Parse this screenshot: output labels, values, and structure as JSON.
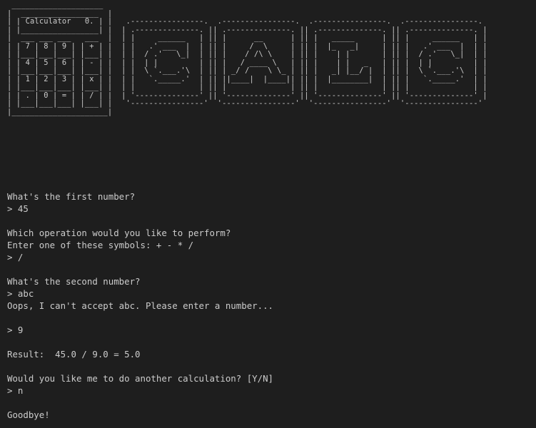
{
  "banner": {
    "art": [
      " ____________________",
      "|  _________________  |",
      "| | Calculator   0. | |   .----------------.  .----------------.  .----------------.  .----------------.",
      "| |_________________| |  | .--------------. || .--------------. || .--------------. || .--------------. |",
      "|  ___ ___ ___   ___  |  | |     ______   | || |      __      | || |   _____      | || |     ______   | |",
      "| | 7 | 8 | 9 | | + | |  | |   .' ___  |  | || |     /  \\     | || |  |_   _|     | || |   .' ___  |  | |",
      "| |___|___|___| |___| |  | |  / .'   \\_|  | || |    / /\\ \\    | || |    | |       | || |  / .'   \\_|  | |",
      "| | 4 | 5 | 6 | | - | |  | |  | |         | || |   / ____ \\   | || |    | |   _   | || |  | |         | |",
      "| |___|___|___| |___| |  | |  \\ `.___.'\\  | || | _/ /    \\ \\_ | || |   _| |__/ |  | || |  \\ `.___.'\\  | |",
      "| | 1 | 2 | 3 | | x | |  | |   `._____.'  | || ||____|  |____|| || |  |________|  | || |   `._____.'  | |",
      "| |___|___|___| |___| |  | |              | || |              | || |              | || |              | |",
      "| | . | 0 | = | | / | |  | '--------------' || '--------------' || '--------------' || '--------------' |",
      "| |___|___|___| |___| |   '----------------'  '----------------'  '----------------'  '----------------'",
      "|_____________________|"
    ]
  },
  "session": [
    {
      "kind": "text",
      "text": "What's the first number?"
    },
    {
      "kind": "input",
      "text": "> 45"
    },
    {
      "kind": "blank",
      "text": ""
    },
    {
      "kind": "text",
      "text": "Which operation would you like to perform?"
    },
    {
      "kind": "text",
      "text": "Enter one of these symbols: + - * /"
    },
    {
      "kind": "input",
      "text": "> /"
    },
    {
      "kind": "blank",
      "text": ""
    },
    {
      "kind": "text",
      "text": "What's the second number?"
    },
    {
      "kind": "input",
      "text": "> abc"
    },
    {
      "kind": "text",
      "text": "Oops, I can't accept abc. Please enter a number..."
    },
    {
      "kind": "blank",
      "text": ""
    },
    {
      "kind": "input",
      "text": "> 9"
    },
    {
      "kind": "blank",
      "text": ""
    },
    {
      "kind": "text",
      "text": "Result:  45.0 / 9.0 = 5.0"
    },
    {
      "kind": "blank",
      "text": ""
    },
    {
      "kind": "text",
      "text": "Would you like me to do another calculation? [Y/N]"
    },
    {
      "kind": "input",
      "text": "> n"
    },
    {
      "kind": "blank",
      "text": ""
    },
    {
      "kind": "text",
      "text": "Goodbye!"
    }
  ]
}
